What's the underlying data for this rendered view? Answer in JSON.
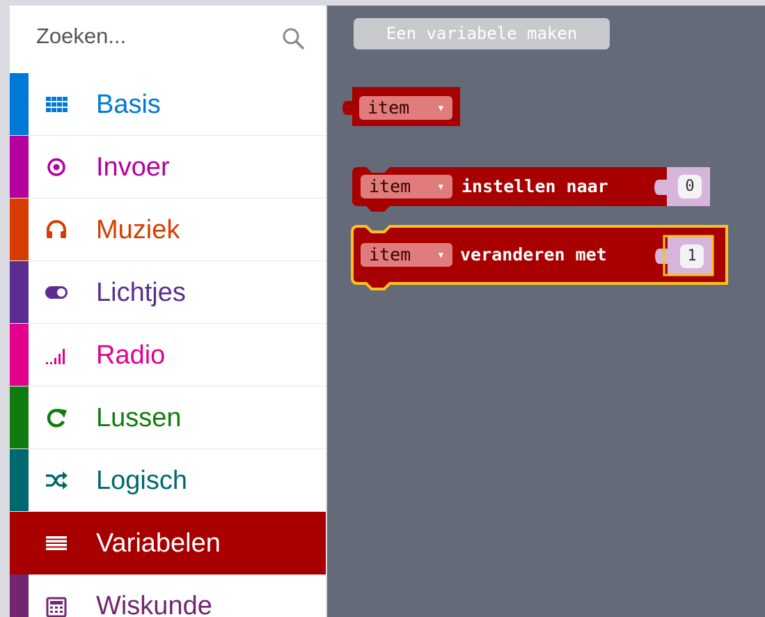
{
  "search": {
    "placeholder": "Zoeken..."
  },
  "categories": [
    {
      "label": "Basis",
      "color": "#0078d7"
    },
    {
      "label": "Invoer",
      "color": "#b4009e"
    },
    {
      "label": "Muziek",
      "color": "#d83b01"
    },
    {
      "label": "Lichtjes",
      "color": "#5c2d91"
    },
    {
      "label": "Radio",
      "color": "#e3008c"
    },
    {
      "label": "Lussen",
      "color": "#107c10"
    },
    {
      "label": "Logisch",
      "color": "#006970"
    },
    {
      "label": "Variabelen",
      "color": "#a80000",
      "selected": true
    },
    {
      "label": "Wiskunde",
      "color": "#712672"
    }
  ],
  "flyout": {
    "make_variable_label": "Een variabele maken",
    "variable_block": {
      "variable": "item"
    },
    "set_block": {
      "variable": "item",
      "text": "instellen naar",
      "value": "0"
    },
    "change_block": {
      "variable": "item",
      "text": "veranderen met",
      "value": "1"
    }
  },
  "colors": {
    "block": "#a80000",
    "workspace": "#646a78",
    "highlight": "#f8c221"
  }
}
